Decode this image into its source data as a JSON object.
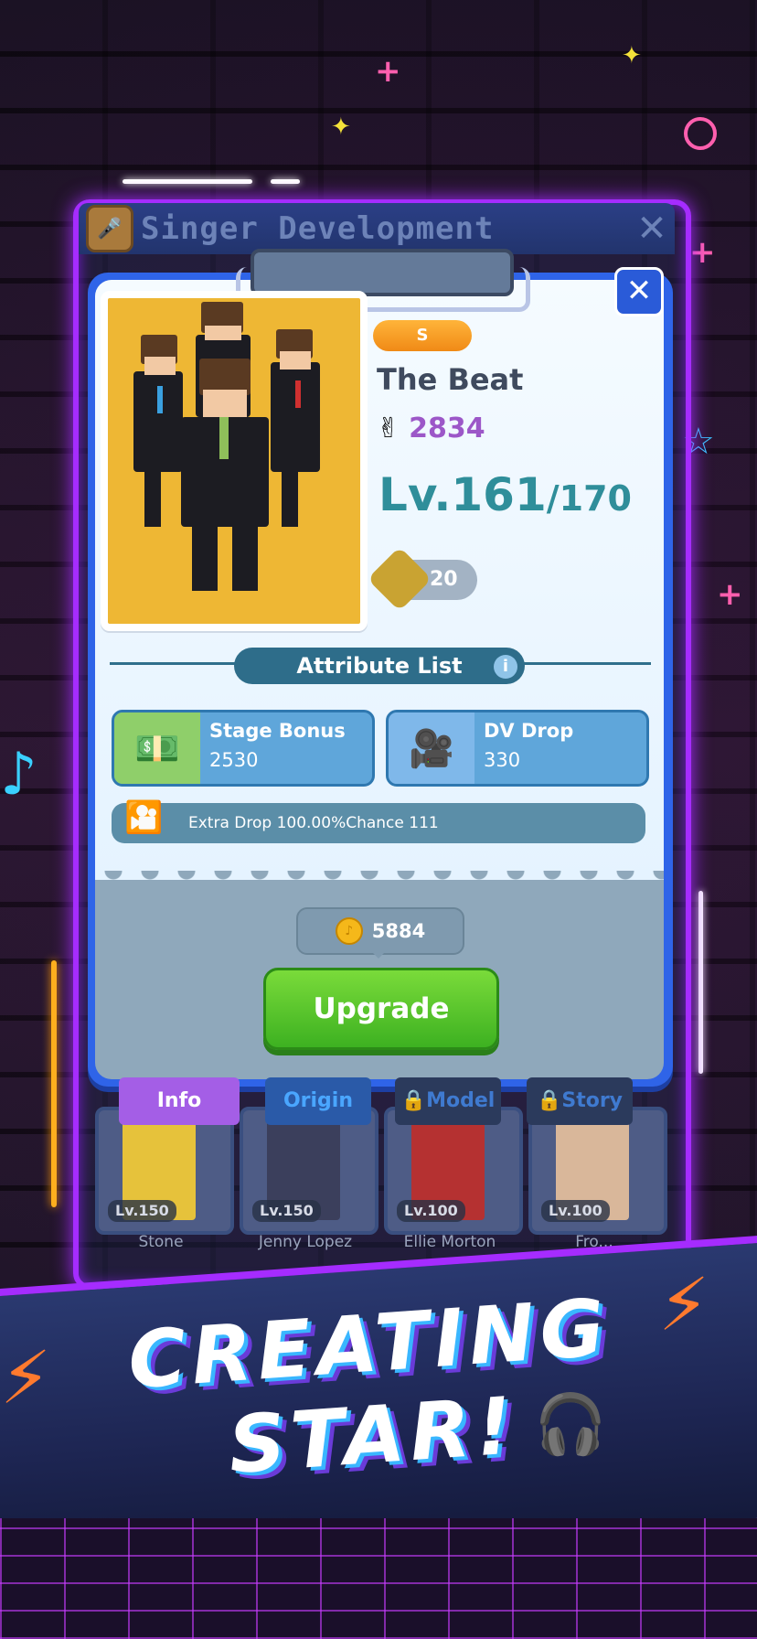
{
  "header": {
    "title": "Singer Development"
  },
  "singer": {
    "rank": "S",
    "name": "The Beat",
    "fans": "2834",
    "level_current": "Lv.161",
    "level_max": "/170",
    "members": "20"
  },
  "attributes": {
    "title": "Attribute List",
    "info_icon": "i",
    "items": [
      {
        "label": "Stage Bonus",
        "value": "2530",
        "icon": "cash-icon"
      },
      {
        "label": "DV Drop",
        "value": "330",
        "icon": "camera-icon"
      }
    ],
    "extra": "Extra Drop 100.00%Chance 111"
  },
  "upgrade": {
    "cost": "5884",
    "label": "Upgrade"
  },
  "tabs": [
    {
      "label": "Info",
      "locked": false,
      "active": true
    },
    {
      "label": "Origin",
      "locked": false,
      "active": false
    },
    {
      "label": "Model",
      "locked": true,
      "active": false
    },
    {
      "label": "Story",
      "locked": true,
      "active": false
    }
  ],
  "heroes": [
    {
      "level": "Lv.150",
      "name": "Stone",
      "color": "#e6c23b"
    },
    {
      "level": "Lv.150",
      "name": "Jenny Lopez",
      "color": "#3b3f5c"
    },
    {
      "level": "Lv.100",
      "name": "Ellie Morton",
      "color": "#b53131"
    },
    {
      "level": "Lv.100",
      "name": "Fro...",
      "color": "#d9b79a"
    }
  ],
  "banner": {
    "line1": "CREATING",
    "line2": "STAR!"
  },
  "colors": {
    "accent": "#a52cff",
    "panel": "#2f64e8",
    "upgrade": "#4ec42a",
    "portrait": "#eeb734"
  }
}
